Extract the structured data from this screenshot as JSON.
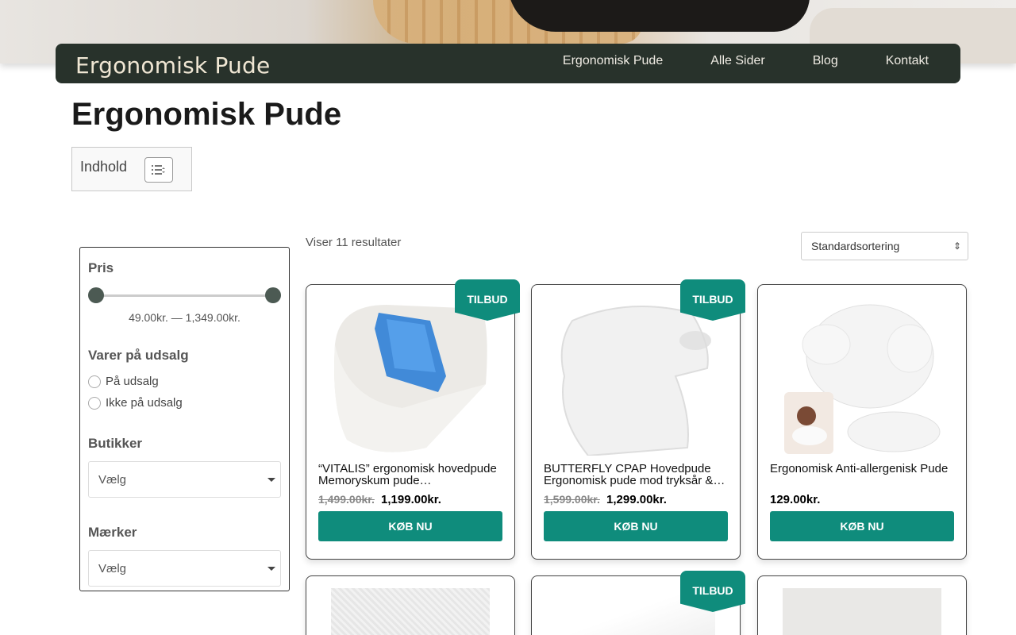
{
  "header": {
    "brand": "Ergonomisk Pude",
    "menu": [
      "Ergonomisk Pude",
      "Alle Sider",
      "Blog",
      "Kontakt"
    ]
  },
  "page_title": "Ergonomisk Pude",
  "toc": {
    "label": "Indhold"
  },
  "sidebar": {
    "price_heading": "Pris",
    "price_range": "49.00kr. — 1,349.00kr.",
    "sale_heading": "Varer på udsalg",
    "sale_options": [
      "På udsalg",
      "Ikke på udsalg"
    ],
    "shops_heading": "Butikker",
    "shops_select": "Vælg",
    "brands_heading": "Mærker",
    "brands_select": "Vælg"
  },
  "results": {
    "count_text": "Viser 11 resultater",
    "sort_value": "Standardsortering"
  },
  "products": [
    {
      "title": "“VITALIS” ergonomisk hovedpude Memoryskum pude…",
      "old_price": "1,499.00kr.",
      "price": "1,199.00kr.",
      "badge": "TILBUD",
      "button": "KØB NU"
    },
    {
      "title": "BUTTERFLY CPAP Hovedpude Ergonomisk pude mod tryksår &…",
      "old_price": "1,599.00kr.",
      "price": "1,299.00kr.",
      "badge": "TILBUD",
      "button": "KØB NU"
    },
    {
      "title": "Ergonomisk Anti-allergenisk Pude",
      "old_price": "",
      "price": "129.00kr.",
      "badge": "",
      "button": "KØB NU"
    },
    {
      "title": "",
      "old_price": "",
      "price": "",
      "badge": "",
      "button": ""
    },
    {
      "title": "",
      "old_price": "",
      "price": "",
      "badge": "TILBUD",
      "button": ""
    },
    {
      "title": "",
      "old_price": "",
      "price": "",
      "badge": "",
      "button": ""
    }
  ],
  "colors": {
    "nav_bg": "#28322b",
    "accent": "#0f8c7c"
  }
}
